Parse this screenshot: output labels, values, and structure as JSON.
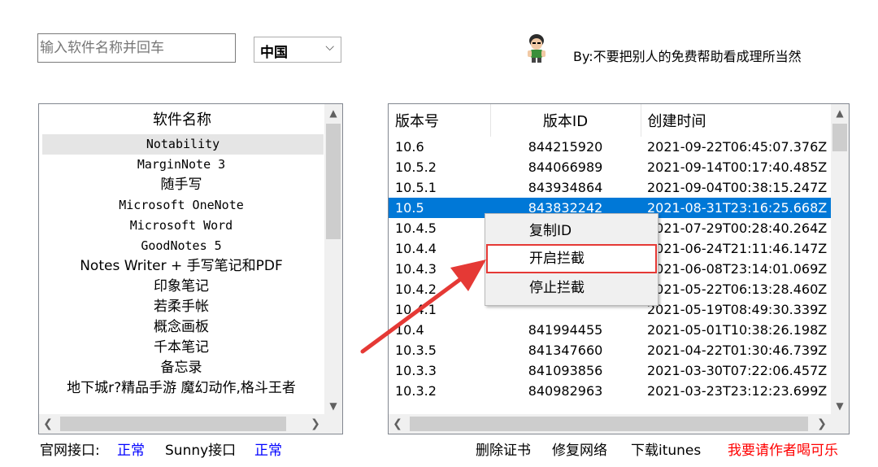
{
  "search": {
    "placeholder": "输入软件名称并回车"
  },
  "region": {
    "selected": "中国",
    "arrow": "⌵"
  },
  "author": {
    "credit": "By:不要把别人的免费帮助看成理所当然"
  },
  "app_list": {
    "header": "软件名称",
    "items": [
      "Notability",
      "MarginNote 3",
      "随手写",
      "Microsoft OneNote",
      "Microsoft Word",
      "GoodNotes 5",
      "Notes Writer + 手写笔记和PDF",
      "印象笔记",
      "若柔手帐",
      "概念画板",
      "千本笔记",
      "备忘录",
      "地下城r?精品手游 魔幻动作,格斗王者"
    ],
    "selected_index": 0
  },
  "versions": {
    "headers": [
      "版本号",
      "版本ID",
      "创建时间"
    ],
    "rows": [
      [
        "10.6",
        "844215920",
        "2021-09-22T06:45:07.376Z"
      ],
      [
        "10.5.2",
        "844066989",
        "2021-09-14T00:17:40.485Z"
      ],
      [
        "10.5.1",
        "843934864",
        "2021-09-04T00:38:15.247Z"
      ],
      [
        "10.5",
        "843832242",
        "2021-08-31T23:16:25.668Z"
      ],
      [
        "10.4.5",
        "",
        "2021-07-29T00:28:40.264Z"
      ],
      [
        "10.4.4",
        "",
        "2021-06-24T21:11:46.147Z"
      ],
      [
        "10.4.3",
        "",
        "2021-06-08T23:14:01.069Z"
      ],
      [
        "10.4.2",
        "",
        "2021-05-22T06:13:28.460Z"
      ],
      [
        "10.4.1",
        "",
        "2021-05-19T08:49:30.339Z"
      ],
      [
        "10.4",
        "841994455",
        "2021-05-01T10:38:26.198Z"
      ],
      [
        "10.3.5",
        "841347660",
        "2021-04-22T01:30:46.739Z"
      ],
      [
        "10.3.3",
        "841093856",
        "2021-03-30T07:22:06.457Z"
      ],
      [
        "10.3.2",
        "840982963",
        "2021-03-23T23:12:23.699Z"
      ]
    ],
    "selected_index": 3
  },
  "context_menu": {
    "items": [
      "复制ID",
      "开启拦截",
      "停止拦截"
    ],
    "highlighted_index": 1
  },
  "status": {
    "official_label": "官网接口:",
    "official_value": "正常",
    "sunny_label": "Sunny接口",
    "sunny_value": "正常"
  },
  "footer_actions": {
    "delete_cert": "删除证书",
    "repair_network": "修复网络",
    "download_itunes": "下载itunes",
    "buy_coffee": "我要请作者喝可乐"
  },
  "colors": {
    "selection": "#0078d7",
    "status_ok": "#0000ff",
    "donate": "#ff0000",
    "annotation": "#e53935"
  },
  "icons": {
    "scroll_up": "▲",
    "scroll_down": "▼",
    "scroll_left": "❮",
    "scroll_right": "❯"
  }
}
